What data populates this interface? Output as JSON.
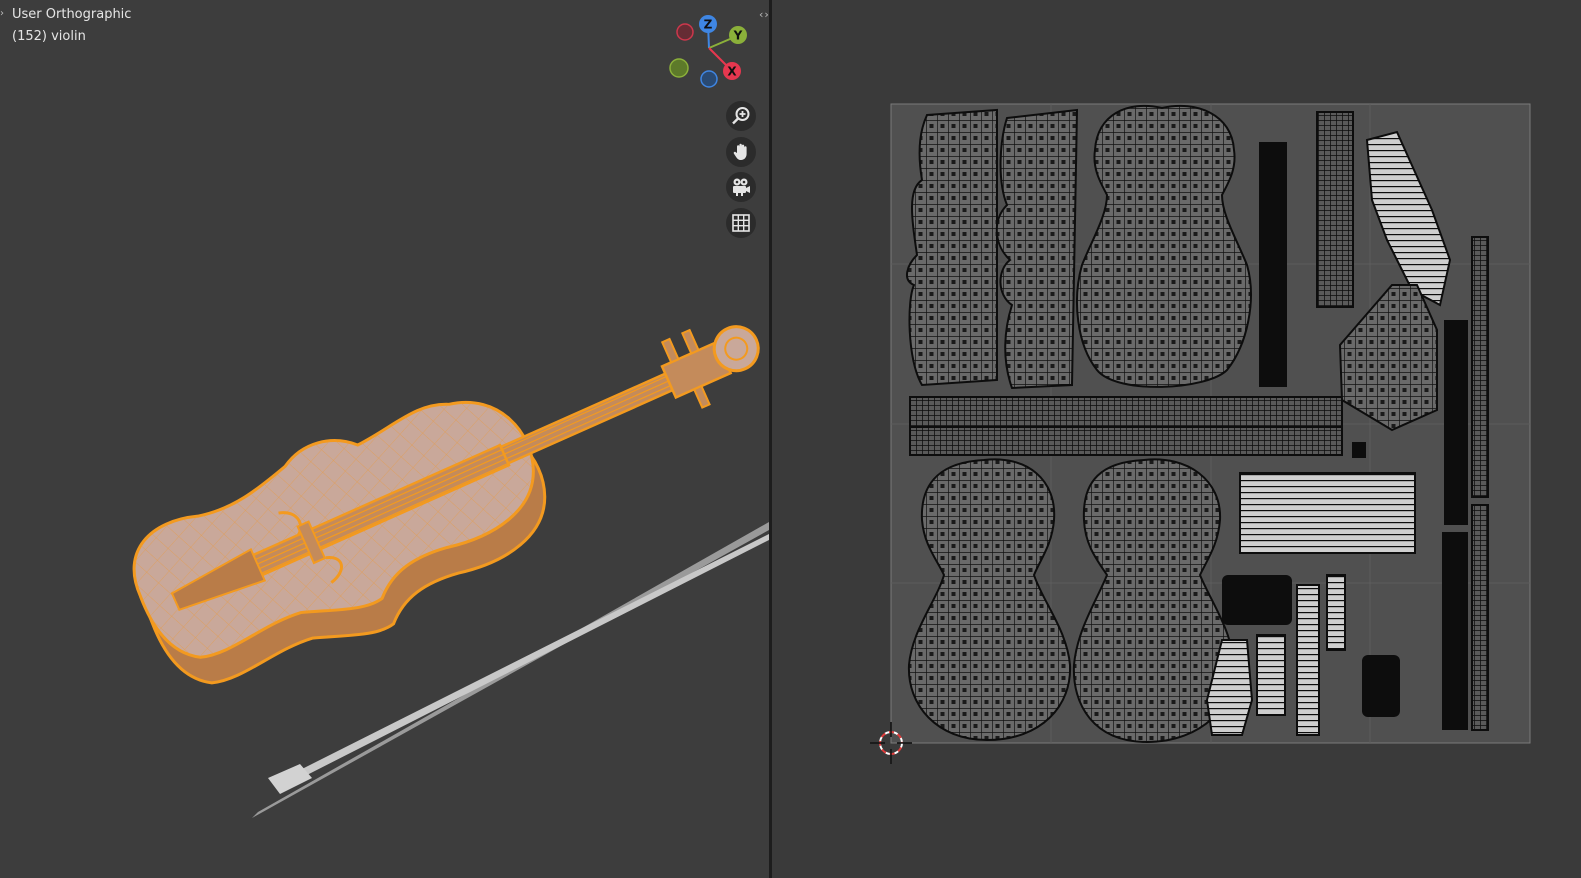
{
  "viewport": {
    "view_label": "User Orthographic",
    "object_label": "(152) violin",
    "expand_icon": "chevron-right-icon",
    "split_icon": "split-arrows-icon"
  },
  "gizmo": {
    "z_label": "Z",
    "y_label": "Y",
    "x_label": "X",
    "colors": {
      "x": "#e7374f",
      "y": "#8bb03a",
      "z": "#3f86e3"
    }
  },
  "tools": [
    {
      "name": "zoom-icon"
    },
    {
      "name": "hand-pan-icon"
    },
    {
      "name": "camera-icon"
    },
    {
      "name": "grid-icon"
    }
  ],
  "colors": {
    "selection": "#f39a1f",
    "violin_surface": "#c9a89a",
    "uv_bg": "#505050",
    "uv_frame": "#7a7a7a"
  },
  "uv_editor": {
    "cursor_icon": "2d-cursor-icon"
  }
}
